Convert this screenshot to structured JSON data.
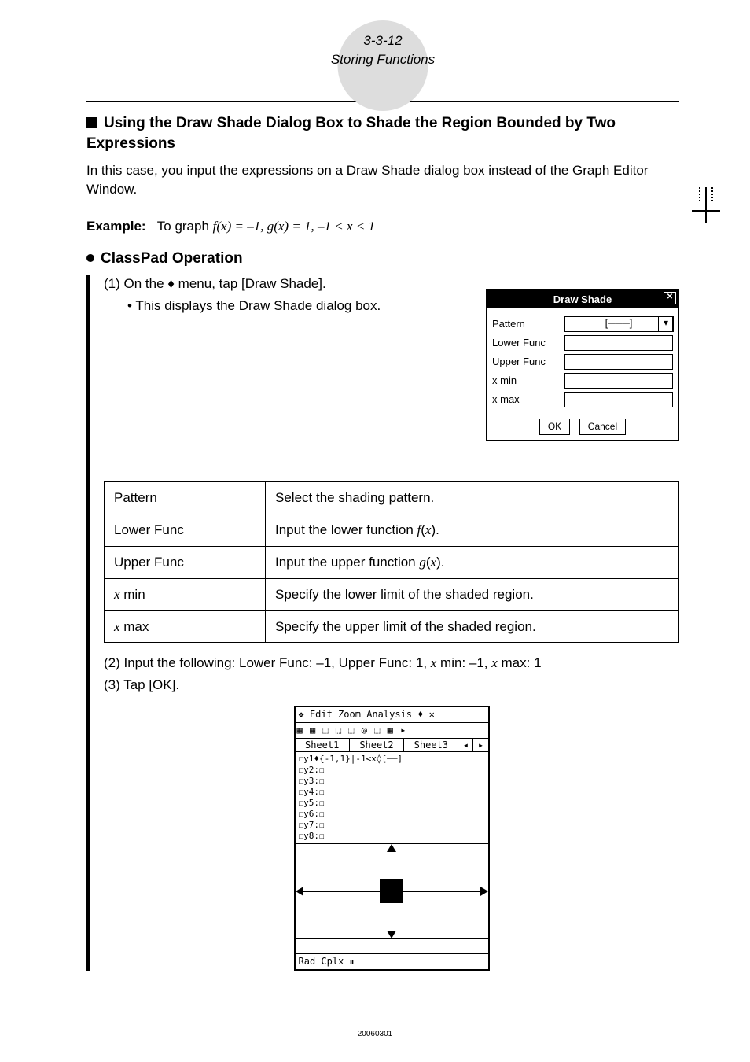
{
  "breadcrumb": {
    "pagecode": "3-3-12",
    "section": "Storing Functions"
  },
  "heading": "Using the Draw Shade Dialog Box to Shade the Region Bounded by Two Expressions",
  "intro": "In this case, you input the expressions on a Draw Shade dialog box instead of the Graph Editor Window.",
  "example": {
    "label": "Example:",
    "text_before": "To graph ",
    "expr": "f(x) = –1, g(x) = 1, –1 < x < 1"
  },
  "operation_head": "ClassPad Operation",
  "steps": {
    "s1_number": "(1)",
    "s1_text_a": " On the ",
    "s1_text_b": " menu, tap [Draw Shade].",
    "s1_bullet": "• This displays the Draw Shade dialog box.",
    "s2": "(2) Input the following: Lower Func: –1, Upper Func: 1, x min: –1, x max: 1",
    "s3": "(3) Tap [OK]."
  },
  "dialog": {
    "title": "Draw Shade",
    "rows": {
      "pattern": "Pattern",
      "lower": "Lower Func",
      "upper": "Upper Func",
      "xmin": "x min",
      "xmax": "x max"
    },
    "pattern_value": "[───]",
    "ok": "OK",
    "cancel": "Cancel"
  },
  "table": [
    {
      "name": "Pattern",
      "desc": "Select the shading pattern."
    },
    {
      "name": "Lower Func",
      "desc": "Input the lower function f(x)."
    },
    {
      "name": "Upper Func",
      "desc": "Input the upper function g(x)."
    },
    {
      "name": "x min",
      "desc": "Specify the lower limit of the shaded region."
    },
    {
      "name": "x max",
      "desc": "Specify the upper limit of the shaded region."
    }
  ],
  "calc": {
    "menu": "❖ Edit Zoom Analysis ♦   ✕",
    "tabs": [
      "Sheet1",
      "Sheet2",
      "Sheet3"
    ],
    "lines": [
      "☐y1♦{-1,1}|-1<x◊[──]",
      "☐y2:☐",
      "☐y3:☐",
      "☐y4:☐",
      "☐y5:☐",
      "☐y6:☐",
      "☐y7:☐",
      "☐y8:☐"
    ],
    "status": "Rad  Cplx              ⏸"
  },
  "footer": "20060301"
}
